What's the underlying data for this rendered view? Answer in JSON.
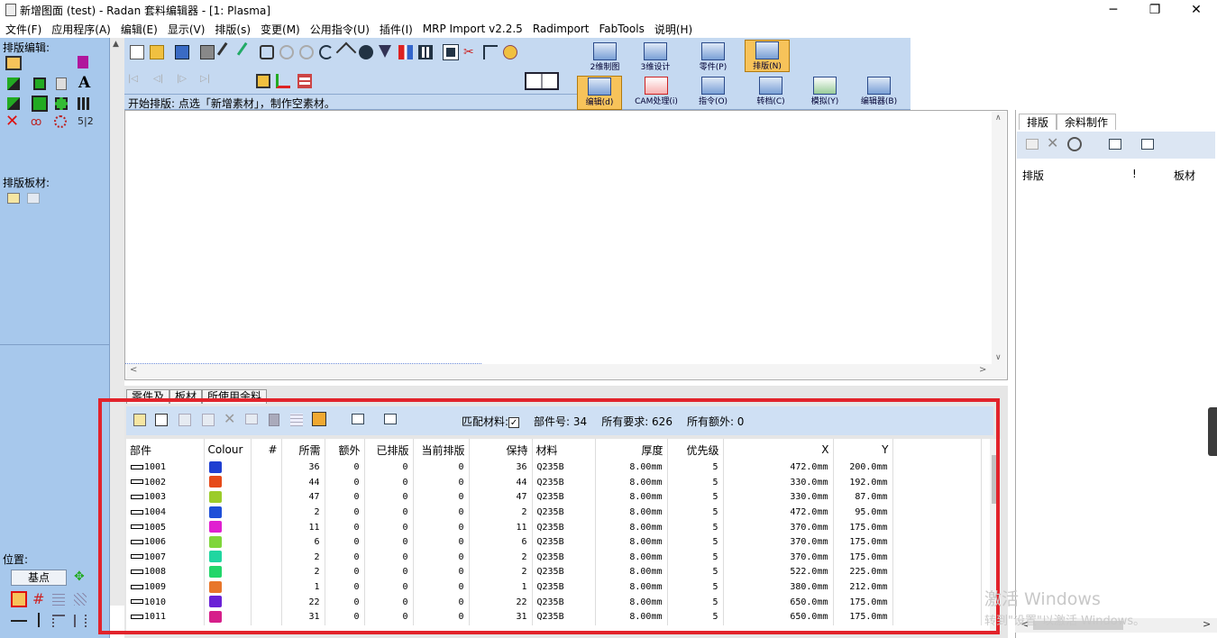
{
  "window": {
    "title": "新增图面 (test) - Radan 套料编辑器 - [1: Plasma]",
    "minimize": "─",
    "restore": "❐",
    "close": "✕"
  },
  "menu": [
    "文件(F)",
    "应用程序(A)",
    "编辑(E)",
    "显示(V)",
    "排版(s)",
    "变更(M)",
    "公用指令(U)",
    "插件(I)",
    "MRP Import v2.2.5",
    "Radimport",
    "FabTools",
    "说明(H)"
  ],
  "left_panel": {
    "section1": "排版编辑:",
    "section2": "排版板材:",
    "position_label": "位置:",
    "base_point_button": "基点",
    "text_tool": "A",
    "ratio_tool": "5|2"
  },
  "toolbar": {
    "big_buttons": [
      {
        "label": "2维制图",
        "icon": "drawing-2d-icon"
      },
      {
        "label": "3维设计",
        "icon": "design-3d-icon"
      },
      {
        "label": "零件(P)",
        "icon": "part-icon"
      },
      {
        "label": "排版(N)",
        "icon": "nest-icon",
        "active": true
      },
      {
        "label": "编辑(d)",
        "icon": "edit-icon",
        "active": true
      },
      {
        "label": "CAM处理(i)",
        "icon": "cam-icon"
      },
      {
        "label": "指令(O)",
        "icon": "command-icon"
      },
      {
        "label": "转档(C)",
        "icon": "convert-icon"
      },
      {
        "label": "模拟(Y)",
        "icon": "simulate-icon"
      },
      {
        "label": "编辑器(B)",
        "icon": "editor-icon"
      }
    ],
    "status_text": "开始排版: 点选「新增素材」，制作空素材。"
  },
  "right_panel": {
    "tabs": [
      "排版",
      "余料制作"
    ],
    "columns": [
      "排版",
      "!",
      "板材"
    ]
  },
  "bottom_panel": {
    "tabs": [
      "零件及",
      "板材",
      "所使用余料"
    ],
    "match_material_label": "匹配材料:",
    "match_material_checked": true,
    "part_count_label": "部件号: 34",
    "total_required_label": "所有要求: 626",
    "total_extra_label": "所有额外: 0",
    "columns": [
      "部件",
      "Colour",
      "#",
      "所需",
      "额外",
      "已排版",
      "当前排版",
      "保持",
      "材料",
      "厚度",
      "优先级",
      "X",
      "Y"
    ],
    "rows": [
      {
        "part": "1001",
        "color": "#1f3fd1",
        "req": "36",
        "extra": "0",
        "nested": "0",
        "current": "0",
        "hold": "36",
        "mat": "Q235B",
        "thk": "8.00mm",
        "pri": "5",
        "x": "472.0mm",
        "y": "200.0mm"
      },
      {
        "part": "1002",
        "color": "#e64a19",
        "req": "44",
        "extra": "0",
        "nested": "0",
        "current": "0",
        "hold": "44",
        "mat": "Q235B",
        "thk": "8.00mm",
        "pri": "5",
        "x": "330.0mm",
        "y": "192.0mm"
      },
      {
        "part": "1003",
        "color": "#9ccc2a",
        "req": "47",
        "extra": "0",
        "nested": "0",
        "current": "0",
        "hold": "47",
        "mat": "Q235B",
        "thk": "8.00mm",
        "pri": "5",
        "x": "330.0mm",
        "y": "87.0mm"
      },
      {
        "part": "1004",
        "color": "#1e4fd8",
        "req": "2",
        "extra": "0",
        "nested": "0",
        "current": "0",
        "hold": "2",
        "mat": "Q235B",
        "thk": "8.00mm",
        "pri": "5",
        "x": "472.0mm",
        "y": "95.0mm"
      },
      {
        "part": "1005",
        "color": "#e01fd0",
        "req": "11",
        "extra": "0",
        "nested": "0",
        "current": "0",
        "hold": "11",
        "mat": "Q235B",
        "thk": "8.00mm",
        "pri": "5",
        "x": "370.0mm",
        "y": "175.0mm"
      },
      {
        "part": "1006",
        "color": "#7fd63a",
        "req": "6",
        "extra": "0",
        "nested": "0",
        "current": "0",
        "hold": "6",
        "mat": "Q235B",
        "thk": "8.00mm",
        "pri": "5",
        "x": "370.0mm",
        "y": "175.0mm"
      },
      {
        "part": "1007",
        "color": "#20d6a0",
        "req": "2",
        "extra": "0",
        "nested": "0",
        "current": "0",
        "hold": "2",
        "mat": "Q235B",
        "thk": "8.00mm",
        "pri": "5",
        "x": "370.0mm",
        "y": "175.0mm"
      },
      {
        "part": "1008",
        "color": "#22d66a",
        "req": "2",
        "extra": "0",
        "nested": "0",
        "current": "0",
        "hold": "2",
        "mat": "Q235B",
        "thk": "8.00mm",
        "pri": "5",
        "x": "522.0mm",
        "y": "225.0mm"
      },
      {
        "part": "1009",
        "color": "#e8762a",
        "req": "1",
        "extra": "0",
        "nested": "0",
        "current": "0",
        "hold": "1",
        "mat": "Q235B",
        "thk": "8.00mm",
        "pri": "5",
        "x": "380.0mm",
        "y": "212.0mm"
      },
      {
        "part": "1010",
        "color": "#6a22d6",
        "req": "22",
        "extra": "0",
        "nested": "0",
        "current": "0",
        "hold": "22",
        "mat": "Q235B",
        "thk": "8.00mm",
        "pri": "5",
        "x": "650.0mm",
        "y": "175.0mm"
      },
      {
        "part": "1011",
        "color": "#d61f8a",
        "req": "31",
        "extra": "0",
        "nested": "0",
        "current": "0",
        "hold": "31",
        "mat": "Q235B",
        "thk": "8.00mm",
        "pri": "5",
        "x": "650.0mm",
        "y": "175.0mm"
      }
    ]
  },
  "watermark": {
    "line1": "激活 Windows",
    "line2": "转到\"设置\"以激活 Windows。"
  },
  "colors": {
    "left_panel": "#a7c8ec",
    "toolbar": "#c5d9f1",
    "highlight_box": "#e2232b",
    "active_button": "#f7c35a"
  }
}
